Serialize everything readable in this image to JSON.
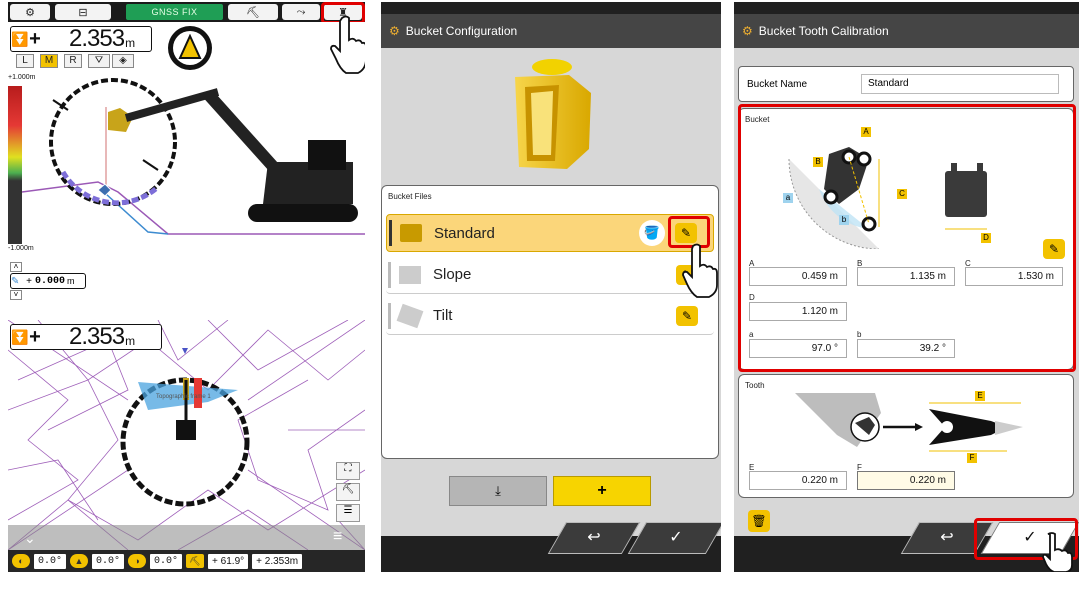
{
  "panel1": {
    "topbar": {
      "gnss_label": "GNSS FIX"
    },
    "elevation_readout": {
      "sign": "+",
      "value": "2.353",
      "unit": "m"
    },
    "lmr_buttons": [
      "L",
      "M",
      "R"
    ],
    "scale": {
      "top": "+1.000m",
      "bottom": "-1.000m"
    },
    "offset_readout": {
      "sign": "+",
      "value": "0.000",
      "unit": "m"
    },
    "plan_readout": {
      "sign": "+",
      "value": "2.353",
      "unit": "m"
    },
    "plan_label": "Topographic frame 1",
    "bottom_values": [
      "0.0°",
      "0.0°",
      "0.0°",
      "61.9°",
      "2.353m"
    ],
    "bottom_signs": [
      "+",
      "+"
    ]
  },
  "panel2": {
    "header_title": "Bucket Configuration",
    "section_title": "Bucket Files",
    "files": [
      {
        "name": "Standard",
        "selected": true
      },
      {
        "name": "Slope",
        "selected": false
      },
      {
        "name": "Tilt",
        "selected": false
      }
    ],
    "import_icon": "import-icon",
    "add_label": "+"
  },
  "panel3": {
    "header_title": "Bucket Tooth Calibration",
    "bucket_name_label": "Bucket Name",
    "bucket_name_value": "Standard",
    "bucket_section": "Bucket",
    "diagram_labels": {
      "A": "A",
      "B": "B",
      "C": "C",
      "D": "D",
      "a": "a",
      "b": "b"
    },
    "fields": {
      "A": {
        "label": "A",
        "value": "0.459 m"
      },
      "B": {
        "label": "B",
        "value": "1.135 m"
      },
      "C": {
        "label": "C",
        "value": "1.530 m"
      },
      "D": {
        "label": "D",
        "value": "1.120 m"
      },
      "a": {
        "label": "a",
        "value": "97.0 °"
      },
      "b": {
        "label": "b",
        "value": "39.2 °"
      }
    },
    "tooth_section": "Tooth",
    "tooth_diagram_labels": {
      "E": "E",
      "F": "F"
    },
    "tooth_fields": {
      "E": {
        "label": "E",
        "value": "0.220 m"
      },
      "F": {
        "label": "F",
        "value": "0.220 m"
      }
    }
  },
  "colors": {
    "accent": "#f2c200",
    "highlight": "#e00000",
    "header": "#454545",
    "gnss": "#1f9e55"
  }
}
